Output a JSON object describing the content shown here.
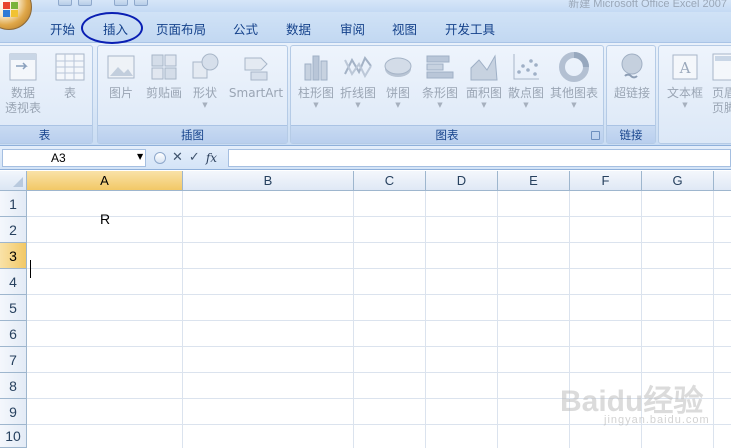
{
  "window": {
    "title": "新建 Microsoft Office Excel 2007"
  },
  "tabs": [
    {
      "label": "开始"
    },
    {
      "label": "插入"
    },
    {
      "label": "页面布局"
    },
    {
      "label": "公式"
    },
    {
      "label": "数据"
    },
    {
      "label": "审阅"
    },
    {
      "label": "视图"
    },
    {
      "label": "开发工具"
    }
  ],
  "active_tab": "插入",
  "ribbon": {
    "groups": {
      "table": {
        "label": "表",
        "buttons": {
          "pivot_line1": "数据",
          "pivot_line2": "透视表",
          "table": "表"
        }
      },
      "illustrations": {
        "label": "插图",
        "buttons": {
          "picture": "图片",
          "clipart": "剪贴画",
          "shapes": "形状",
          "smartart": "SmartArt"
        }
      },
      "charts": {
        "label": "图表",
        "buttons": {
          "column": "柱形图",
          "line": "折线图",
          "pie": "饼图",
          "bar": "条形图",
          "area": "面积图",
          "scatter": "散点图",
          "other": "其他图表"
        }
      },
      "links": {
        "label": "链接",
        "buttons": {
          "hyperlink": "超链接"
        }
      },
      "text": {
        "buttons": {
          "textbox": "文本框",
          "header_line1": "页眉",
          "header_line2": "页脚"
        }
      }
    }
  },
  "formula_bar": {
    "name_box": "A3",
    "fx": "fx",
    "content": ""
  },
  "sheet": {
    "columns": [
      "A",
      "B",
      "C",
      "D",
      "E",
      "F",
      "G"
    ],
    "rows": [
      "1",
      "2",
      "3",
      "4",
      "5",
      "6",
      "7",
      "8",
      "9",
      "10"
    ],
    "active_cell": "A3",
    "cells": {
      "A1": "R"
    }
  },
  "watermark": {
    "main": "Baidu经验",
    "sub": "jingyan.baidu.com"
  },
  "colors": {
    "ribbon_bg": "#dbe8f7",
    "tab_text": "#15428b",
    "highlight_circle": "#0a1fb3",
    "active_header": "#f2c866"
  }
}
